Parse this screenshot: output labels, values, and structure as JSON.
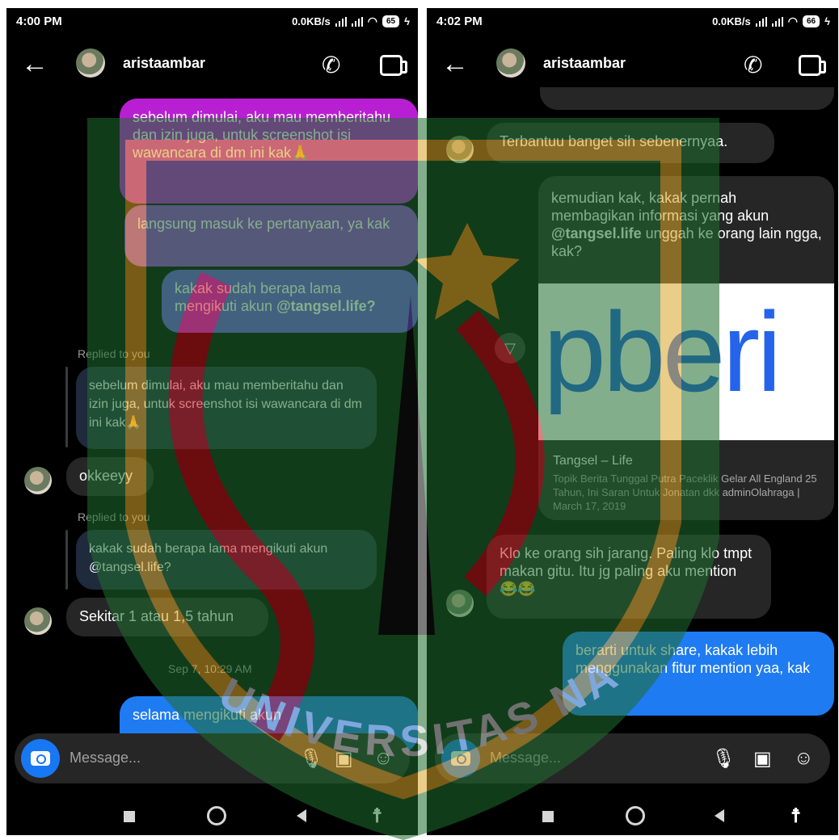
{
  "left": {
    "status": {
      "time": "4:00 PM",
      "speed": "0.0KB/s",
      "battery": "65"
    },
    "header": {
      "username": "aristaambar"
    },
    "messages": {
      "m1": "sebelum dimulai, aku mau memberitahu dan izin juga, untuk screenshot isi wawancara di dm ini kak🙏",
      "m2": "langsung masuk ke pertanyaan, ya kak",
      "m3_pre": "kakak sudah berapa lama mengikuti akun ",
      "m3_bold": "@tangsel.life?",
      "replied1": "Replied to you",
      "quote1": "sebelum dimulai, aku mau memberitahu dan izin juga, untuk screenshot isi wawancara di dm ini kak🙏",
      "m4": "okkeeyy",
      "replied2": "Replied to you",
      "quote2": "kakak sudah berapa lama mengikuti akun @tangsel.life?",
      "m5": "Sekitar 1 atau 1,5 tahun",
      "timestamp": "Sep 7, 10:29 AM",
      "m6": "selama mengikuti akun"
    },
    "composer": {
      "placeholder": "Message..."
    }
  },
  "right": {
    "status": {
      "time": "4:02 PM",
      "speed": "0.0KB/s",
      "battery": "66"
    },
    "header": {
      "username": "aristaambar"
    },
    "messages": {
      "m1": "Terbantuu banget sih sebenernyaa.",
      "m2_pre": "kemudian kak, kakak pernah membagikan informasi yang akun ",
      "m2_bold": "@tangsel.life",
      "m2_post": " unggah ke orang lain ngga, kak?",
      "card_logo": "pberi",
      "card_title": "Tangsel – Life",
      "card_desc": "Topik Berita Tunggal Putra Paceklik Gelar All England 25 Tahun, Ini Saran Untuk Jonatan dkk adminOlahraga | March 17, 2019",
      "m3": "Klo ke orang sih jarang. Paling klo tmpt makan gitu. Itu jg paling aku mention 😂😂",
      "m4": "berarti untuk share, kakak lebih menggunakan fitur mention yaa, kak"
    },
    "composer": {
      "placeholder": "Message..."
    }
  },
  "watermark": {
    "text": "UNIVERSITAS NASIONAL"
  },
  "colors": {
    "gradient_top": "#b81fd2",
    "gradient_mid": "#7a4ddf",
    "gradient_blue": "#1f7bf2",
    "incoming": "#262626",
    "camera": "#1877f2"
  },
  "icons": [
    "back-arrow-icon",
    "phone-call-icon",
    "video-call-icon",
    "camera-icon",
    "microphone-icon",
    "gallery-icon",
    "sticker-icon",
    "share-icon",
    "recents-icon",
    "home-icon",
    "back-icon",
    "accessibility-icon"
  ]
}
